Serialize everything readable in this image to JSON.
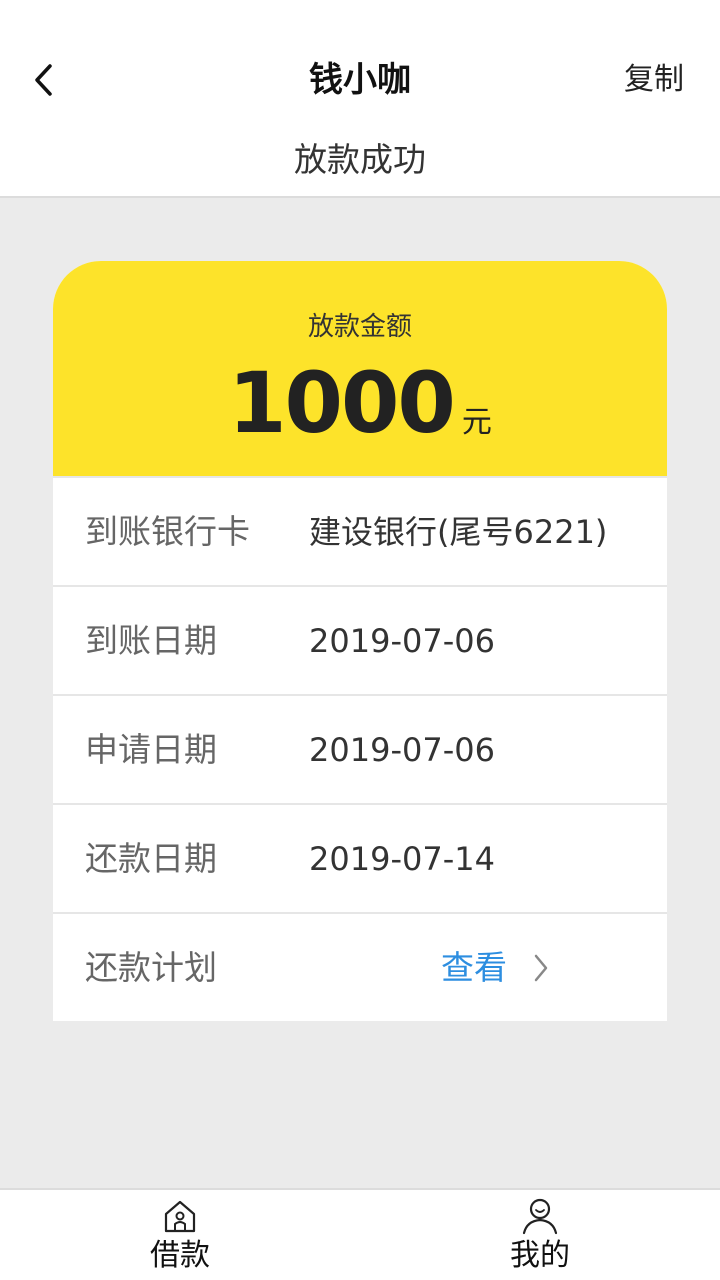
{
  "header": {
    "back_icon": "chevron-left-icon",
    "app_title": "钱小咖",
    "copy_label": "复制",
    "page_title": "放款成功"
  },
  "card": {
    "amount_label": "放款金额",
    "amount_value": "1000",
    "amount_unit": "元",
    "rows": [
      {
        "label": "到账银行卡",
        "value": "建设银行(尾号6221)"
      },
      {
        "label": "到账日期",
        "value": "2019-07-06"
      },
      {
        "label": "申请日期",
        "value": "2019-07-06"
      },
      {
        "label": "还款日期",
        "value": "2019-07-14"
      },
      {
        "label": "还款计划",
        "link": "查看",
        "link_icon": "chevron-right-icon"
      }
    ]
  },
  "bottom_nav": {
    "items": [
      {
        "label": "借款",
        "icon": "home-icon"
      },
      {
        "label": "我的",
        "icon": "user-icon"
      }
    ]
  },
  "colors": {
    "accent_yellow": "#fde32a",
    "link_blue": "#2d8ee0",
    "background": "#ebebeb"
  }
}
